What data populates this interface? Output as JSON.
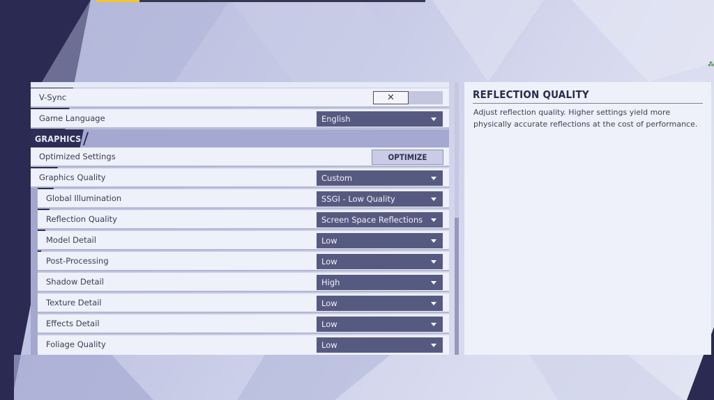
{
  "settings": {
    "vsync": {
      "label": "V-Sync",
      "value_icon": "x-icon",
      "value_glyph": "✕",
      "enabled": false
    },
    "game_language": {
      "label": "Game Language",
      "value": "English"
    },
    "graphics_section": {
      "title": "GRAPHICS"
    },
    "optimized_settings": {
      "label": "Optimized Settings",
      "button_label": "OPTIMIZE"
    },
    "graphics_quality": {
      "label": "Graphics Quality",
      "value": "Custom"
    },
    "sub_settings": [
      {
        "label": "Global Illumination",
        "value": "SSGI - Low Quality"
      },
      {
        "label": "Reflection Quality",
        "value": "Screen Space Reflections"
      },
      {
        "label": "Model Detail",
        "value": "Low"
      },
      {
        "label": "Post-Processing",
        "value": "Low"
      },
      {
        "label": "Shadow Detail",
        "value": "High"
      },
      {
        "label": "Texture Detail",
        "value": "Low"
      },
      {
        "label": "Effects Detail",
        "value": "Low"
      },
      {
        "label": "Foliage Quality",
        "value": "Low"
      }
    ]
  },
  "info_panel": {
    "title": "REFLECTION QUALITY",
    "description": "Adjust reflection quality. Higher settings yield more physically accurate reflections at the cost of performance."
  },
  "colors": {
    "dropdown_bg": "#575a80",
    "section_header_bg": "#a5a9d2",
    "section_tag_bg": "#2d2d55",
    "accent_yellow": "#f2c531"
  }
}
